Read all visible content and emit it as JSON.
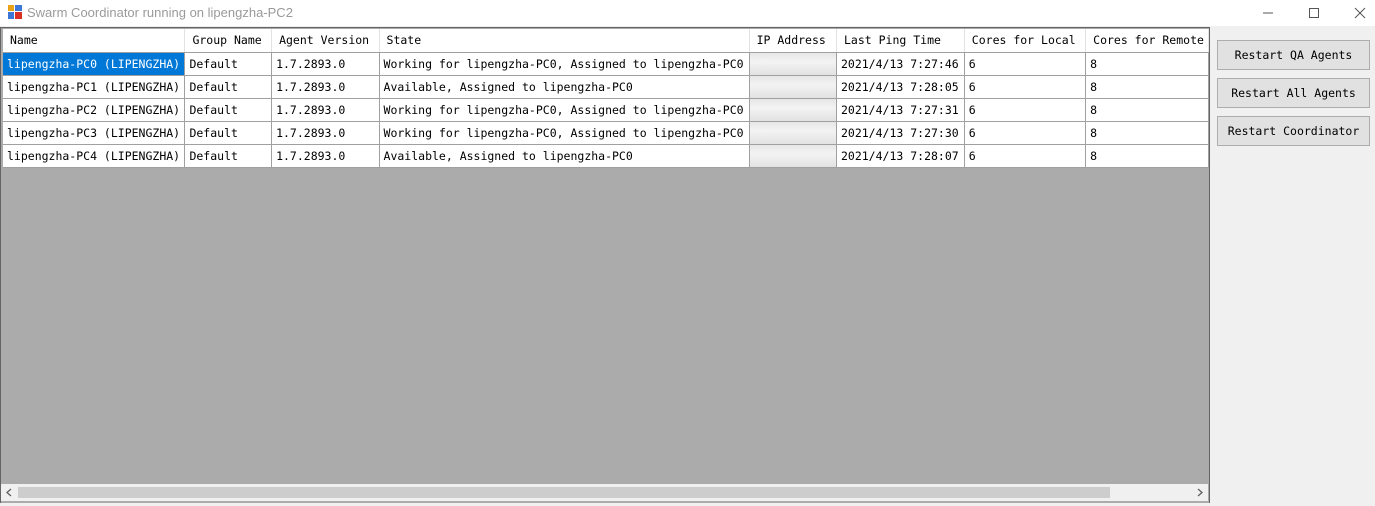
{
  "window": {
    "title": "Swarm Coordinator running on lipengzha-PC2"
  },
  "grid": {
    "columns": [
      "Name",
      "Group Name",
      "Agent Version",
      "State",
      "IP Address",
      "Last Ping Time",
      "Cores for Local",
      "Cores for Remote"
    ],
    "rows": [
      {
        "name": "lipengzha-PC0 (LIPENGZHA)",
        "group": "Default",
        "version": "1.7.2893.0",
        "state": "Working for lipengzha-PC0, Assigned to lipengzha-PC0",
        "ip": "",
        "ping": "2021/4/13 7:27:46",
        "cores_local": "6",
        "cores_remote": "8"
      },
      {
        "name": "lipengzha-PC1 (LIPENGZHA)",
        "group": "Default",
        "version": "1.7.2893.0",
        "state": "Available, Assigned to lipengzha-PC0",
        "ip": "",
        "ping": "2021/4/13 7:28:05",
        "cores_local": "6",
        "cores_remote": "8"
      },
      {
        "name": "lipengzha-PC2 (LIPENGZHA)",
        "group": "Default",
        "version": "1.7.2893.0",
        "state": "Working for lipengzha-PC0, Assigned to lipengzha-PC0",
        "ip": "",
        "ping": "2021/4/13 7:27:31",
        "cores_local": "6",
        "cores_remote": "8"
      },
      {
        "name": "lipengzha-PC3 (LIPENGZHA)",
        "group": "Default",
        "version": "1.7.2893.0",
        "state": "Working for lipengzha-PC0, Assigned to lipengzha-PC0",
        "ip": "",
        "ping": "2021/4/13 7:27:30",
        "cores_local": "6",
        "cores_remote": "8"
      },
      {
        "name": "lipengzha-PC4 (LIPENGZHA)",
        "group": "Default",
        "version": "1.7.2893.0",
        "state": "Available, Assigned to lipengzha-PC0",
        "ip": "",
        "ping": "2021/4/13 7:28:07",
        "cores_local": "6",
        "cores_remote": "8"
      }
    ],
    "selected_row": 0
  },
  "buttons": {
    "restart_qa": "Restart QA Agents",
    "restart_all": "Restart All Agents",
    "restart_coordinator": "Restart Coordinator"
  },
  "colors": {
    "selection": "#0078d7",
    "grid_background": "#ababab"
  },
  "icons": [
    "app-icon",
    "minimize-icon",
    "maximize-icon",
    "close-icon",
    "scroll-left-icon",
    "scroll-right-icon"
  ]
}
